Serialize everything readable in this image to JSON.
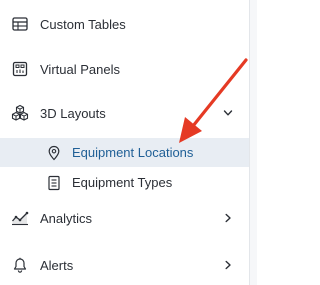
{
  "nav": {
    "items": [
      {
        "label": "Custom Tables",
        "icon": "table-icon"
      },
      {
        "label": "Virtual Panels",
        "icon": "virtual-panel-icon"
      },
      {
        "label": "3D Layouts",
        "icon": "cubes-icon",
        "expanded": true,
        "children": [
          {
            "label": "Equipment Locations",
            "icon": "location-pin-icon",
            "active": true
          },
          {
            "label": "Equipment Types",
            "icon": "equipment-type-icon"
          }
        ]
      },
      {
        "label": "Analytics",
        "icon": "analytics-icon"
      },
      {
        "label": "Alerts",
        "icon": "bell-icon"
      }
    ]
  },
  "colors": {
    "active_background": "#e8edf3",
    "active_text": "#1f5f96",
    "annotation_arrow": "#e53a24"
  }
}
